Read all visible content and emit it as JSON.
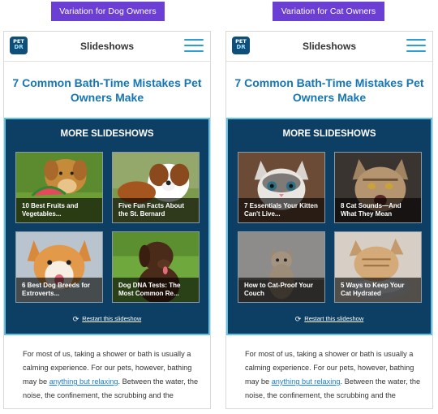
{
  "variants": [
    {
      "badge": "Variation for Dog Owners",
      "header": {
        "logo_top": "PET",
        "logo_bottom": "DR",
        "title": "Slideshows"
      },
      "article_title": "7 Common Bath-Time Mistakes Pet Owners Make",
      "more": {
        "heading": "MORE SLIDESHOWS",
        "tiles": [
          {
            "caption": "10 Best Fruits and Vegetables..."
          },
          {
            "caption": "Five Fun Facts About the St. Bernard"
          },
          {
            "caption": "6 Best Dog Breeds for Extroverts..."
          },
          {
            "caption": "Dog DNA Tests: The Most Common Re..."
          }
        ],
        "restart": "Restart this slideshow"
      },
      "body": {
        "before": "For most of us, taking a shower or bath is usually a calming experience. For our pets, however, bathing may be ",
        "link": "anything but relaxing",
        "after": ". Between the water, the noise, the confinement, the scrubbing and the"
      }
    },
    {
      "badge": "Variation for Cat Owners",
      "header": {
        "logo_top": "PET",
        "logo_bottom": "DR",
        "title": "Slideshows"
      },
      "article_title": "7 Common Bath-Time Mistakes Pet Owners Make",
      "more": {
        "heading": "MORE SLIDESHOWS",
        "tiles": [
          {
            "caption": "7 Essentials Your Kitten Can't Live..."
          },
          {
            "caption": "8 Cat Sounds—And What They Mean"
          },
          {
            "caption": "How to Cat-Proof Your Couch"
          },
          {
            "caption": "5 Ways to Keep Your Cat Hydrated"
          }
        ],
        "restart": "Restart this slideshow"
      },
      "body": {
        "before": "For most of us, taking a shower or bath is usually a calming experience. For our pets, however, bathing may be ",
        "link": "anything but relaxing",
        "after": ". Between the water, the noise, the confinement, the scrubbing and the"
      }
    }
  ],
  "colors": {
    "badge_bg": "#6c3fd4",
    "title_blue": "#1576b3",
    "slideshow_bg": "#0d3e63",
    "slideshow_border": "#5fc4e8",
    "link": "#1a7fc4"
  }
}
